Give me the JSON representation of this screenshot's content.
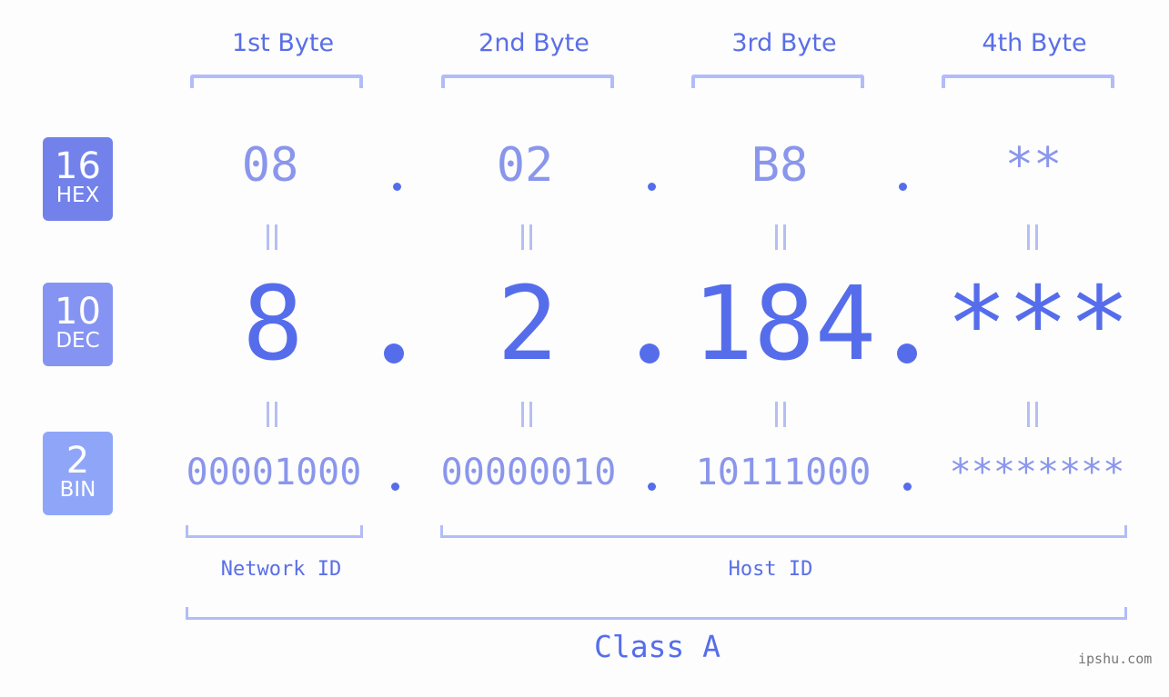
{
  "bytes": [
    {
      "label": "1st Byte",
      "hex": "08",
      "dec": "8",
      "bin": "00001000"
    },
    {
      "label": "2nd Byte",
      "hex": "02",
      "dec": "2",
      "bin": "00000010"
    },
    {
      "label": "3rd Byte",
      "hex": "B8",
      "dec": "184",
      "bin": "10111000"
    },
    {
      "label": "4th Byte",
      "hex": "**",
      "dec": "***",
      "bin": "********"
    }
  ],
  "bases": {
    "hex": {
      "number": "16",
      "label": "HEX"
    },
    "dec": {
      "number": "10",
      "label": "DEC"
    },
    "bin": {
      "number": "2",
      "label": "BIN"
    }
  },
  "segments": {
    "network": "Network ID",
    "host": "Host ID",
    "class": "Class A"
  },
  "watermark": "ipshu.com",
  "colors": {
    "accent": "#566deb",
    "hex_badge": "#7282ea",
    "dec_badge": "#8594f2",
    "bin_badge": "#8fa6f8",
    "bracket": "#b2bcf8"
  }
}
